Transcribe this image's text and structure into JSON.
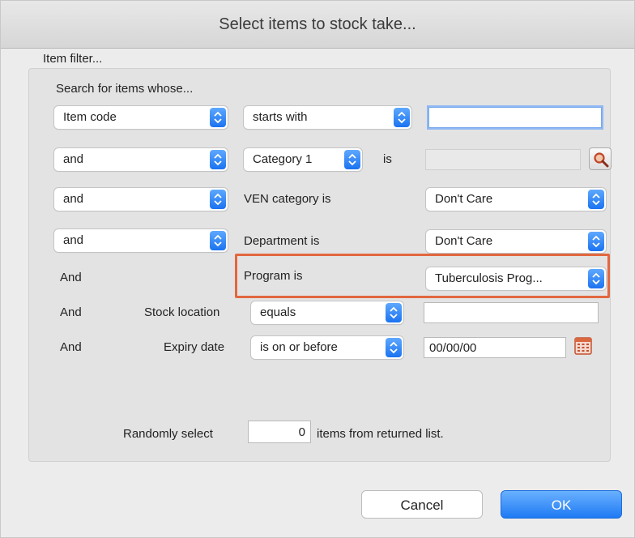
{
  "window": {
    "title": "Select items to stock take..."
  },
  "filter": {
    "group_label": "Item filter...",
    "intro": "Search for items whose...",
    "row1": {
      "field": "Item code",
      "op": "starts with",
      "value": ""
    },
    "row2": {
      "conj": "and",
      "field": "Category 1",
      "is_label": "is",
      "value": ""
    },
    "row3": {
      "conj": "and",
      "label": "VEN category is",
      "value": "Don't Care"
    },
    "row4": {
      "conj": "and",
      "label": "Department is",
      "value": "Don't Care"
    },
    "row5": {
      "conj": "And",
      "label": "Program is",
      "value": "Tuberculosis Prog..."
    },
    "row6": {
      "conj": "And",
      "label": "Stock location",
      "op": "equals",
      "value": ""
    },
    "row7": {
      "conj": "And",
      "label": "Expiry date",
      "op": "is on or before",
      "value": "00/00/00"
    },
    "random": {
      "label": "Randomly select",
      "count": "0",
      "suffix": "items from returned list."
    }
  },
  "buttons": {
    "cancel": "Cancel",
    "ok": "OK"
  },
  "colors": {
    "accent": "#1f7af3",
    "highlight": "#e2673f"
  }
}
